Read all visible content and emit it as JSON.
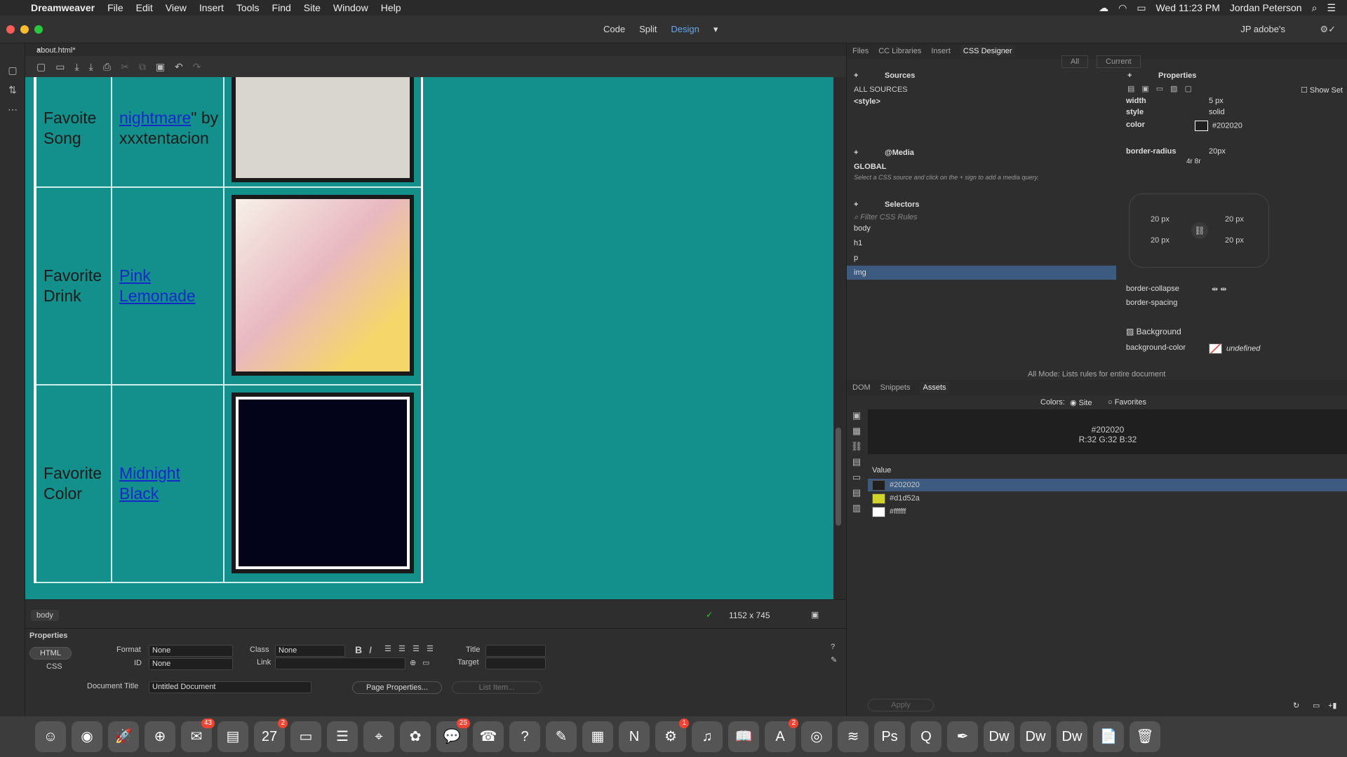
{
  "menubar": {
    "app": "Dreamweaver",
    "items": [
      "File",
      "Edit",
      "View",
      "Insert",
      "Tools",
      "Find",
      "Site",
      "Window",
      "Help"
    ],
    "clock": "Wed 11:23 PM",
    "user": "Jordan Peterson"
  },
  "titlebar": {
    "views": [
      "Code",
      "Split",
      "Design"
    ],
    "active_view": "Design",
    "workspace": "JP adobe's"
  },
  "doc": {
    "tab": "about.html*"
  },
  "canvas": {
    "rows": [
      {
        "label": "Favoite Song",
        "link": "nightmare",
        "suffix": "\" by xxxtentacion"
      },
      {
        "label": "Favorite Drink",
        "link": "Pink Lemonade"
      },
      {
        "label": "Favorite Color",
        "link": "Midnight Black"
      }
    ]
  },
  "status": {
    "tag": "body",
    "size": "1152 x 745"
  },
  "properties": {
    "title": "Properties",
    "html_label": "HTML",
    "css_label": "CSS",
    "format_label": "Format",
    "format_value": "None",
    "id_label": "ID",
    "id_value": "None",
    "class_label": "Class",
    "class_value": "None",
    "link_label": "Link",
    "title_label": "Title",
    "target_label": "Target",
    "doctitle_label": "Document Title",
    "doctitle_value": "Untitled Document",
    "page_props": "Page Properties...",
    "list_item": "List Item..."
  },
  "right": {
    "tabs": [
      "Files",
      "CC Libraries",
      "Insert",
      "CSS Designer"
    ],
    "mode_all": "All",
    "mode_current": "Current",
    "sources": "Sources",
    "all_sources": "ALL SOURCES",
    "style": "<style>",
    "media": "@Media",
    "global": "GLOBAL",
    "media_hint": "Select a CSS source and click on the + sign to add a media query.",
    "selectors": "Selectors",
    "filter": "Filter CSS Rules",
    "selector_list": [
      "body",
      "h1",
      "p",
      "img"
    ],
    "properties_hdr": "Properties",
    "show_set": "Show Set",
    "props": [
      {
        "name": "width",
        "value": "5 px"
      },
      {
        "name": "style",
        "value": "solid"
      },
      {
        "name": "color",
        "value": "#202020"
      }
    ],
    "border_radius": "border-radius",
    "border_radius_value": "20px",
    "radius_modes": "4r  8r",
    "radius_values": [
      "20 px",
      "20 px",
      "20 px",
      "20 px"
    ],
    "border_collapse": "border-collapse",
    "border_spacing": "border-spacing",
    "background": "Background",
    "background_color": "background-color",
    "bg_value": "undefined",
    "mode_hint": "All Mode: Lists rules for entire document",
    "bottom_tabs": [
      "DOM",
      "Snippets",
      "Assets"
    ],
    "colors_label": "Colors:",
    "site": "Site",
    "favorites": "Favorites",
    "preview_hex": "#202020",
    "preview_rgb": "R:32 G:32 B:32",
    "value_hdr": "Value",
    "swatches": [
      {
        "hex": "#202020",
        "color": "#202020"
      },
      {
        "hex": "#d1d52a",
        "color": "#d1d52a"
      },
      {
        "hex": "#ffffff",
        "color": "#ffffff"
      }
    ],
    "apply": "Apply"
  },
  "dock": [
    {
      "name": "finder-icon",
      "glyph": "☺",
      "badge": ""
    },
    {
      "name": "siri-icon",
      "glyph": "◉",
      "badge": ""
    },
    {
      "name": "launchpad-icon",
      "glyph": "🚀",
      "badge": ""
    },
    {
      "name": "safari-icon",
      "glyph": "⊕",
      "badge": ""
    },
    {
      "name": "mail-icon",
      "glyph": "✉",
      "badge": "43"
    },
    {
      "name": "notes-icon",
      "glyph": "▤",
      "badge": ""
    },
    {
      "name": "calendar-icon",
      "glyph": "27",
      "badge": "2"
    },
    {
      "name": "stickies-icon",
      "glyph": "▭",
      "badge": ""
    },
    {
      "name": "reminders-icon",
      "glyph": "☰",
      "badge": ""
    },
    {
      "name": "maps-icon",
      "glyph": "⌖",
      "badge": ""
    },
    {
      "name": "photos-icon",
      "glyph": "✿",
      "badge": ""
    },
    {
      "name": "messages-icon",
      "glyph": "💬",
      "badge": "25"
    },
    {
      "name": "facetime-icon",
      "glyph": "☎",
      "badge": ""
    },
    {
      "name": "help-icon",
      "glyph": "?",
      "badge": ""
    },
    {
      "name": "pages-icon",
      "glyph": "✎",
      "badge": ""
    },
    {
      "name": "keynote-icon",
      "glyph": "▦",
      "badge": ""
    },
    {
      "name": "news-icon",
      "glyph": "N",
      "badge": ""
    },
    {
      "name": "system-preferences-icon",
      "glyph": "⚙",
      "badge": "1"
    },
    {
      "name": "music-icon",
      "glyph": "♫",
      "badge": ""
    },
    {
      "name": "books-icon",
      "glyph": "📖",
      "badge": ""
    },
    {
      "name": "app-store-icon",
      "glyph": "A",
      "badge": "2"
    },
    {
      "name": "chrome-icon",
      "glyph": "◎",
      "badge": ""
    },
    {
      "name": "spotify-icon",
      "glyph": "≋",
      "badge": ""
    },
    {
      "name": "photoshop-icon",
      "glyph": "Ps",
      "badge": ""
    },
    {
      "name": "quicktime-icon",
      "glyph": "Q",
      "badge": ""
    },
    {
      "name": "script-editor-icon",
      "glyph": "✒",
      "badge": ""
    },
    {
      "name": "dreamweaver-icon",
      "glyph": "Dw",
      "badge": ""
    },
    {
      "name": "dreamweaver-2-icon",
      "glyph": "Dw",
      "badge": ""
    },
    {
      "name": "dreamweaver-3-icon",
      "glyph": "Dw",
      "badge": ""
    },
    {
      "name": "document-icon",
      "glyph": "📄",
      "badge": ""
    },
    {
      "name": "trash-icon",
      "glyph": "🗑",
      "badge": ""
    }
  ]
}
